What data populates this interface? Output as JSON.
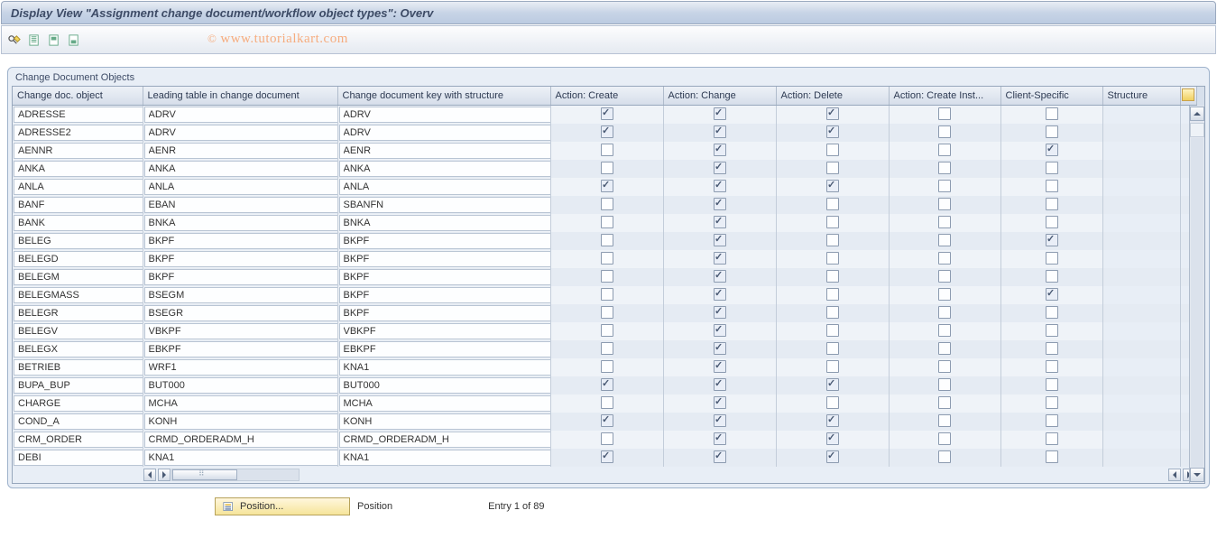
{
  "title": "Display View \"Assignment change document/workflow object types\": Overv",
  "watermark": "www.tutorialkart.com",
  "panel_title": "Change Document Objects",
  "columns": [
    "Change doc. object",
    "Leading table in change document",
    "Change document key with structure",
    "Action: Create",
    "Action: Change",
    "Action: Delete",
    "Action: Create Inst...",
    "Client-Specific",
    "Structure"
  ],
  "rows": [
    {
      "o": "ADRESSE",
      "t": "ADRV",
      "k": "ADRV",
      "cr": true,
      "ch": true,
      "de": true,
      "ci": false,
      "cs": false
    },
    {
      "o": "ADRESSE2",
      "t": "ADRV",
      "k": "ADRV",
      "cr": true,
      "ch": true,
      "de": true,
      "ci": false,
      "cs": false
    },
    {
      "o": "AENNR",
      "t": "AENR",
      "k": "AENR",
      "cr": false,
      "ch": true,
      "de": false,
      "ci": false,
      "cs": true
    },
    {
      "o": "ANKA",
      "t": "ANKA",
      "k": "ANKA",
      "cr": false,
      "ch": true,
      "de": false,
      "ci": false,
      "cs": false
    },
    {
      "o": "ANLA",
      "t": "ANLA",
      "k": "ANLA",
      "cr": true,
      "ch": true,
      "de": true,
      "ci": false,
      "cs": false
    },
    {
      "o": "BANF",
      "t": "EBAN",
      "k": "SBANFN",
      "cr": false,
      "ch": true,
      "de": false,
      "ci": false,
      "cs": false
    },
    {
      "o": "BANK",
      "t": "BNKA",
      "k": "BNKA",
      "cr": false,
      "ch": true,
      "de": false,
      "ci": false,
      "cs": false
    },
    {
      "o": "BELEG",
      "t": "BKPF",
      "k": "BKPF",
      "cr": false,
      "ch": true,
      "de": false,
      "ci": false,
      "cs": true
    },
    {
      "o": "BELEGD",
      "t": "BKPF",
      "k": "BKPF",
      "cr": false,
      "ch": true,
      "de": false,
      "ci": false,
      "cs": false
    },
    {
      "o": "BELEGM",
      "t": "BKPF",
      "k": "BKPF",
      "cr": false,
      "ch": true,
      "de": false,
      "ci": false,
      "cs": false
    },
    {
      "o": "BELEGMASS",
      "t": "BSEGM",
      "k": "BKPF",
      "cr": false,
      "ch": true,
      "de": false,
      "ci": false,
      "cs": true
    },
    {
      "o": "BELEGR",
      "t": "BSEGR",
      "k": "BKPF",
      "cr": false,
      "ch": true,
      "de": false,
      "ci": false,
      "cs": false
    },
    {
      "o": "BELEGV",
      "t": "VBKPF",
      "k": "VBKPF",
      "cr": false,
      "ch": true,
      "de": false,
      "ci": false,
      "cs": false
    },
    {
      "o": "BELEGX",
      "t": "EBKPF",
      "k": "EBKPF",
      "cr": false,
      "ch": true,
      "de": false,
      "ci": false,
      "cs": false
    },
    {
      "o": "BETRIEB",
      "t": "WRF1",
      "k": "KNA1",
      "cr": false,
      "ch": true,
      "de": false,
      "ci": false,
      "cs": false
    },
    {
      "o": "BUPA_BUP",
      "t": "BUT000",
      "k": "BUT000",
      "cr": true,
      "ch": true,
      "de": true,
      "ci": false,
      "cs": false
    },
    {
      "o": "CHARGE",
      "t": "MCHA",
      "k": "MCHA",
      "cr": false,
      "ch": true,
      "de": false,
      "ci": false,
      "cs": false
    },
    {
      "o": "COND_A",
      "t": "KONH",
      "k": "KONH",
      "cr": true,
      "ch": true,
      "de": true,
      "ci": false,
      "cs": false
    },
    {
      "o": "CRM_ORDER",
      "t": "CRMD_ORDERADM_H",
      "k": "CRMD_ORDERADM_H",
      "cr": false,
      "ch": true,
      "de": true,
      "ci": false,
      "cs": false
    },
    {
      "o": "DEBI",
      "t": "KNA1",
      "k": "KNA1",
      "cr": true,
      "ch": true,
      "de": true,
      "ci": false,
      "cs": false
    }
  ],
  "footer": {
    "position_btn": "Position...",
    "position_label": "Position",
    "entry": "Entry 1 of 89"
  }
}
